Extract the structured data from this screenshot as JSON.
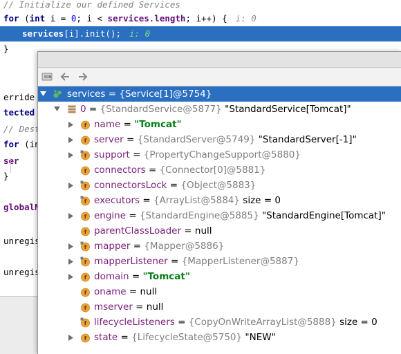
{
  "editor": {
    "lines": [
      {
        "segments": [
          {
            "cls": "cmt",
            "text": "// Initialize our defined Services"
          }
        ]
      },
      {
        "segments": [
          {
            "cls": "kw",
            "text": "for"
          },
          {
            "cls": "",
            "text": " ("
          },
          {
            "cls": "kw",
            "text": "int"
          },
          {
            "cls": "",
            "text": " i = "
          },
          {
            "cls": "num",
            "text": "0"
          },
          {
            "cls": "",
            "text": "; i < "
          },
          {
            "cls": "fld",
            "text": "services"
          },
          {
            "cls": "",
            "text": "."
          },
          {
            "cls": "fld",
            "text": "length"
          },
          {
            "cls": "",
            "text": "; i++) {"
          },
          {
            "cls": "hint",
            "text": "i: 0"
          }
        ]
      },
      {
        "segments": [
          {
            "cls": "fld",
            "text": "services"
          },
          {
            "cls": "",
            "text": "[i].init();"
          },
          {
            "cls": "hint",
            "text": "i: 0"
          }
        ]
      },
      {
        "segments": [
          {
            "cls": "",
            "text": "}"
          }
        ]
      },
      {
        "segments": [
          {
            "cls": "",
            "text": "erride"
          }
        ]
      },
      {
        "segments": [
          {
            "cls": "kw",
            "text": "tected v"
          }
        ]
      },
      {
        "segments": [
          {
            "cls": "cmt",
            "text": "// Dest"
          }
        ]
      },
      {
        "segments": [
          {
            "cls": "kw",
            "text": "for"
          },
          {
            "cls": "",
            "text": " (in"
          }
        ]
      },
      {
        "segments": [
          {
            "cls": "fld",
            "text": "ser"
          }
        ]
      },
      {
        "segments": [
          {
            "cls": "",
            "text": "}"
          }
        ]
      },
      {
        "segments": [
          {
            "cls": "fld",
            "text": "globalN"
          }
        ]
      },
      {
        "segments": [
          {
            "cls": "",
            "text": "unregis"
          }
        ]
      },
      {
        "segments": [
          {
            "cls": "",
            "text": "unregis"
          }
        ]
      }
    ]
  },
  "toolbar": {
    "icons": [
      "watch-icon",
      "back-arrow-icon",
      "forward-arrow-icon"
    ]
  },
  "tree": {
    "root": {
      "name": "services",
      "value": "{Service[1]@5754}"
    },
    "child0": {
      "name": "0",
      "value": "{StandardService@5877}",
      "desc": "\"StandardService[Tomcat]\""
    },
    "fields": [
      {
        "name": "name",
        "ref": "",
        "tail": "\"Tomcat\"",
        "tail_cls": "str",
        "expandable": true,
        "lock": false
      },
      {
        "name": "server",
        "ref": "{StandardServer@5749}",
        "tail": "\"StandardServer[-1]\"",
        "tail_cls": "plain",
        "expandable": true,
        "lock": false
      },
      {
        "name": "support",
        "ref": "{PropertyChangeSupport@5880}",
        "tail": "",
        "tail_cls": "plain",
        "expandable": true,
        "lock": true
      },
      {
        "name": "connectors",
        "ref": "{Connector[0]@5881}",
        "tail": "",
        "tail_cls": "plain",
        "expandable": false,
        "lock": false
      },
      {
        "name": "connectorsLock",
        "ref": "{Object@5883}",
        "tail": "",
        "tail_cls": "plain",
        "expandable": true,
        "lock": true
      },
      {
        "name": "executors",
        "ref": "{ArrayList@5884}",
        "tail": "size = 0",
        "tail_cls": "plain",
        "expandable": false,
        "lock": true
      },
      {
        "name": "engine",
        "ref": "{StandardEngine@5885}",
        "tail": "\"StandardEngine[Tomcat]\"",
        "tail_cls": "plain",
        "expandable": true,
        "lock": false
      },
      {
        "name": "parentClassLoader",
        "ref": "",
        "tail": "null",
        "tail_cls": "plain",
        "expandable": false,
        "lock": false
      },
      {
        "name": "mapper",
        "ref": "{Mapper@5886}",
        "tail": "",
        "tail_cls": "plain",
        "expandable": true,
        "lock": true
      },
      {
        "name": "mapperListener",
        "ref": "{MapperListener@5887}",
        "tail": "",
        "tail_cls": "plain",
        "expandable": true,
        "lock": true
      },
      {
        "name": "domain",
        "ref": "",
        "tail": "\"Tomcat\"",
        "tail_cls": "str",
        "expandable": true,
        "lock": false
      },
      {
        "name": "oname",
        "ref": "",
        "tail": "null",
        "tail_cls": "plain",
        "expandable": false,
        "lock": false
      },
      {
        "name": "mserver",
        "ref": "",
        "tail": "null",
        "tail_cls": "plain",
        "expandable": false,
        "lock": false
      },
      {
        "name": "lifecycleListeners",
        "ref": "{CopyOnWriteArrayList@5888}",
        "tail": "size = 0",
        "tail_cls": "plain",
        "expandable": false,
        "lock": true
      },
      {
        "name": "state",
        "ref": "{LifecycleState@5750}",
        "tail": "\"NEW\"",
        "tail_cls": "plain",
        "expandable": true,
        "lock": false
      }
    ]
  },
  "colors": {
    "selection": "#2b6fc1",
    "field_icon": "#e8a33a",
    "string_value": "#067d17",
    "var_name": "#7a1f7a"
  }
}
